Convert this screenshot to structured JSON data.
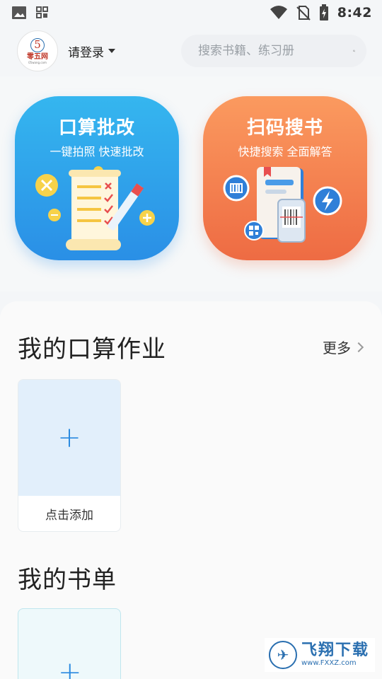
{
  "status_bar": {
    "time": "8:42",
    "left_icons": [
      "image-icon",
      "apps-icon"
    ],
    "right_icons": [
      "wifi-icon",
      "no-sim-icon",
      "battery-icon"
    ]
  },
  "header": {
    "logo": {
      "number": "5",
      "text": "零五网",
      "url": "05wang.com"
    },
    "login_label": "请登录",
    "search_placeholder": "搜索书籍、练习册"
  },
  "feature_cards": [
    {
      "title": "口算批改",
      "subtitle": "一键拍照 快速批改",
      "color": "#2a8fe6"
    },
    {
      "title": "扫码搜书",
      "subtitle": "快捷搜索 全面解答",
      "color": "#ee6b43"
    }
  ],
  "homework_section": {
    "title": "我的口算作业",
    "more_label": "更多",
    "add_tile": {
      "plus": "+",
      "label": "点击添加"
    }
  },
  "booklist_section": {
    "title": "我的书单",
    "add_tile": {
      "plus": "+"
    }
  },
  "watermark": {
    "name": "飞翔下载",
    "url": "www.FXXZ.com"
  },
  "colors": {
    "accent_blue": "#2a8ae0",
    "accent_orange": "#ee6b43",
    "background": "#f4f6f8"
  }
}
